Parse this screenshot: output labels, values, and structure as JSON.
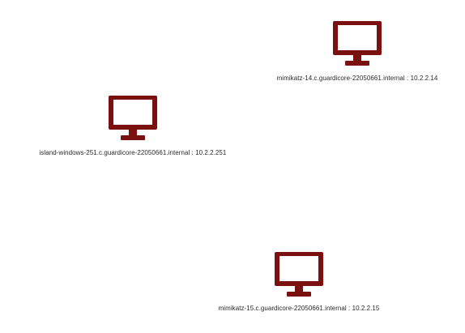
{
  "colors": {
    "machine_icon": "#7a1010",
    "label_text": "#2a2a2a",
    "background": "#ffffff"
  },
  "nodes": [
    {
      "icon": "monitor-icon",
      "label": "mimikatz-14.c.guardicore-22050661.internal : 10.2.2.14"
    },
    {
      "icon": "monitor-icon",
      "label": "island-windows-251.c.guardicore-22050661.internal : 10.2.2.251"
    },
    {
      "icon": "monitor-icon",
      "label": "mimikatz-15.c.guardicore-22050661.internal : 10.2.2.15"
    }
  ]
}
